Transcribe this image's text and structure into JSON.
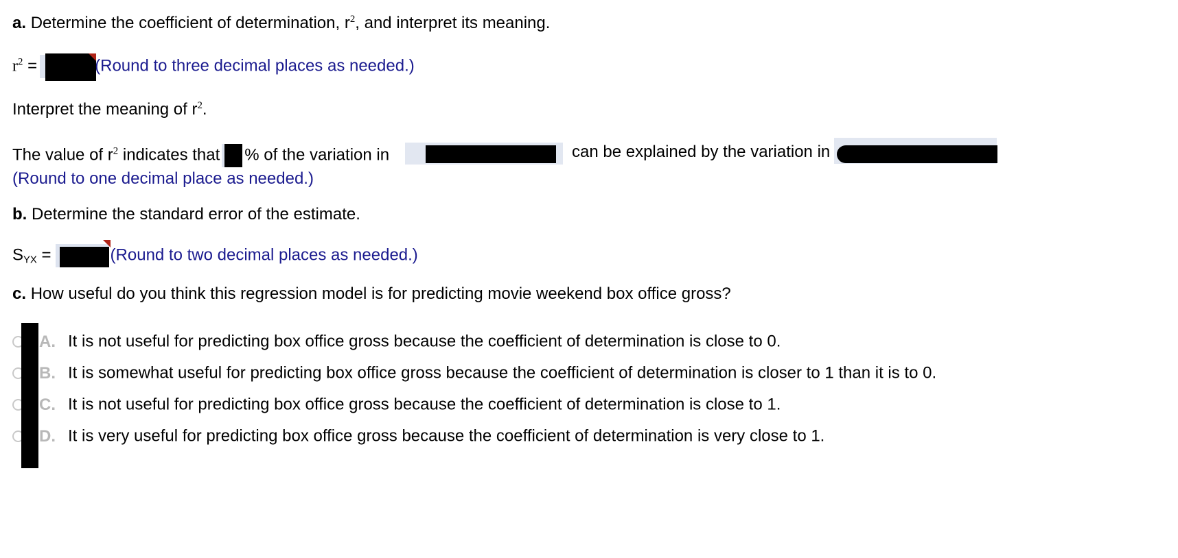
{
  "question": {
    "part_a": {
      "label": "a.",
      "prompt_before": "Determine the coefficient of determination, r",
      "prompt_exp": "2",
      "prompt_after": ", and interpret its meaning.",
      "equation_var": "r",
      "equation_exp": "2",
      "equation_eq": "=",
      "round_hint": "(Round to three decimal places as needed.)",
      "interpret_before": "Interpret the meaning of r",
      "interpret_exp": "2",
      "interpret_after": ".",
      "value_before": "The value of r",
      "value_exp": "2",
      "value_mid": "indicates that",
      "percent_symbol": "% of the variation in",
      "value_middle_text": "can be explained by the variation in",
      "round_hint_2": "(Round to one decimal place as needed.)"
    },
    "part_b": {
      "label": "b.",
      "prompt": "Determine the standard error of the estimate.",
      "equation_var": "S",
      "equation_sub": "YX",
      "equation_eq": "=",
      "round_hint": "(Round to two decimal places as needed.)"
    },
    "part_c": {
      "label": "c.",
      "prompt": "How useful do you think this regression model is for predicting movie weekend box office gross?",
      "options": [
        {
          "letter": "A.",
          "text": "It is not useful for predicting box office gross because the coefficient of determination is close to 0."
        },
        {
          "letter": "B.",
          "text": "It is somewhat useful for predicting box office gross because the coefficient of determination is closer to 1 than it is to 0."
        },
        {
          "letter": "C.",
          "text": "It is not useful for predicting box office gross because the coefficient of determination is close to 1."
        },
        {
          "letter": "D.",
          "text": "It is very useful for predicting box office gross because the coefficient of determination is very close to 1."
        }
      ]
    }
  },
  "fields": {
    "r_squared_value": "",
    "percent_value": "",
    "dropdown_1_value": "",
    "dropdown_2_value": "",
    "syx_value": ""
  },
  "colors": {
    "hint_blue": "#1b1b8f",
    "input_background": "#dde3ef",
    "dropdown_background": "#e2e7f1",
    "flag_red": "#b02418",
    "option_letter_gray": "#b8b8b8",
    "radio_border_gray": "#c9c9c9"
  }
}
